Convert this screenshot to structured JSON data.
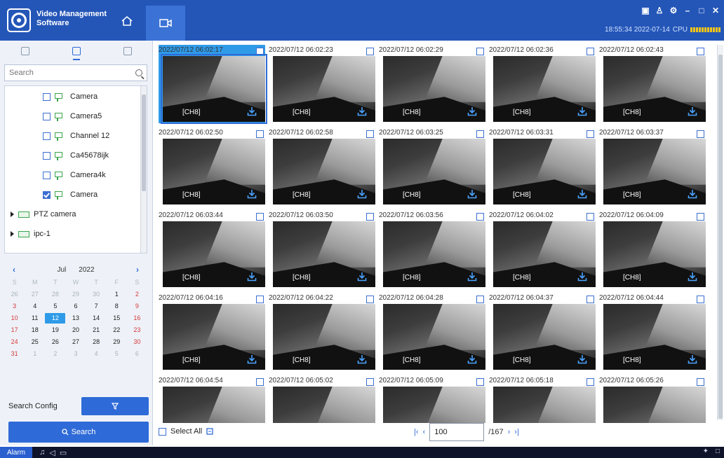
{
  "app": {
    "title": "Video Management Software"
  },
  "header": {
    "time": "18:55:34 2022-07-14",
    "cpu_label": "CPU",
    "cpu_level": 0.6
  },
  "sidebar": {
    "search_placeholder": "Search",
    "tree": [
      {
        "label": "Camera",
        "checked": false,
        "type": "camera"
      },
      {
        "label": "Camera5",
        "checked": false,
        "type": "camera"
      },
      {
        "label": "Channel 12",
        "checked": false,
        "type": "camera"
      },
      {
        "label": "Ca45678ijk",
        "checked": false,
        "type": "camera"
      },
      {
        "label": "Camera4k",
        "checked": false,
        "type": "camera"
      },
      {
        "label": "Camera",
        "checked": true,
        "type": "camera"
      },
      {
        "label": "PTZ camera",
        "type": "group"
      },
      {
        "label": "ipc-1",
        "type": "group"
      }
    ],
    "calendar": {
      "month": "Jul",
      "year": "2022",
      "weekdays": [
        "S",
        "M",
        "T",
        "W",
        "T",
        "F",
        "S"
      ],
      "weeks": [
        [
          "26",
          "27",
          "28",
          "29",
          "30",
          "1",
          "2"
        ],
        [
          "3",
          "4",
          "5",
          "6",
          "7",
          "8",
          "9"
        ],
        [
          "10",
          "11",
          "12",
          "13",
          "14",
          "15",
          "16"
        ],
        [
          "17",
          "18",
          "19",
          "20",
          "21",
          "22",
          "23"
        ],
        [
          "24",
          "25",
          "26",
          "27",
          "28",
          "29",
          "30"
        ],
        [
          "31",
          "1",
          "2",
          "3",
          "4",
          "5",
          "6"
        ]
      ],
      "selected": "12"
    },
    "search_config_label": "Search Config",
    "search_button_label": "Search"
  },
  "grid": {
    "channel_label": "[CH8]",
    "timestamps": [
      "2022/07/12 06:02:17",
      "2022/07/12 06:02:23",
      "2022/07/12 06:02:29",
      "2022/07/12 06:02:36",
      "2022/07/12 06:02:43",
      "2022/07/12 06:02:50",
      "2022/07/12 06:02:58",
      "2022/07/12 06:03:25",
      "2022/07/12 06:03:31",
      "2022/07/12 06:03:37",
      "2022/07/12 06:03:44",
      "2022/07/12 06:03:50",
      "2022/07/12 06:03:56",
      "2022/07/12 06:04:02",
      "2022/07/12 06:04:09",
      "2022/07/12 06:04:16",
      "2022/07/12 06:04:22",
      "2022/07/12 06:04:28",
      "2022/07/12 06:04:37",
      "2022/07/12 06:04:44",
      "2022/07/12 06:04:54",
      "2022/07/12 06:05:02",
      "2022/07/12 06:05:09",
      "2022/07/12 06:05:18",
      "2022/07/12 06:05:26"
    ]
  },
  "footer": {
    "select_all_label": "Select All",
    "page_value": "100",
    "total_pages": "/167"
  },
  "bottombar": {
    "alarm_label": "Alarm"
  }
}
